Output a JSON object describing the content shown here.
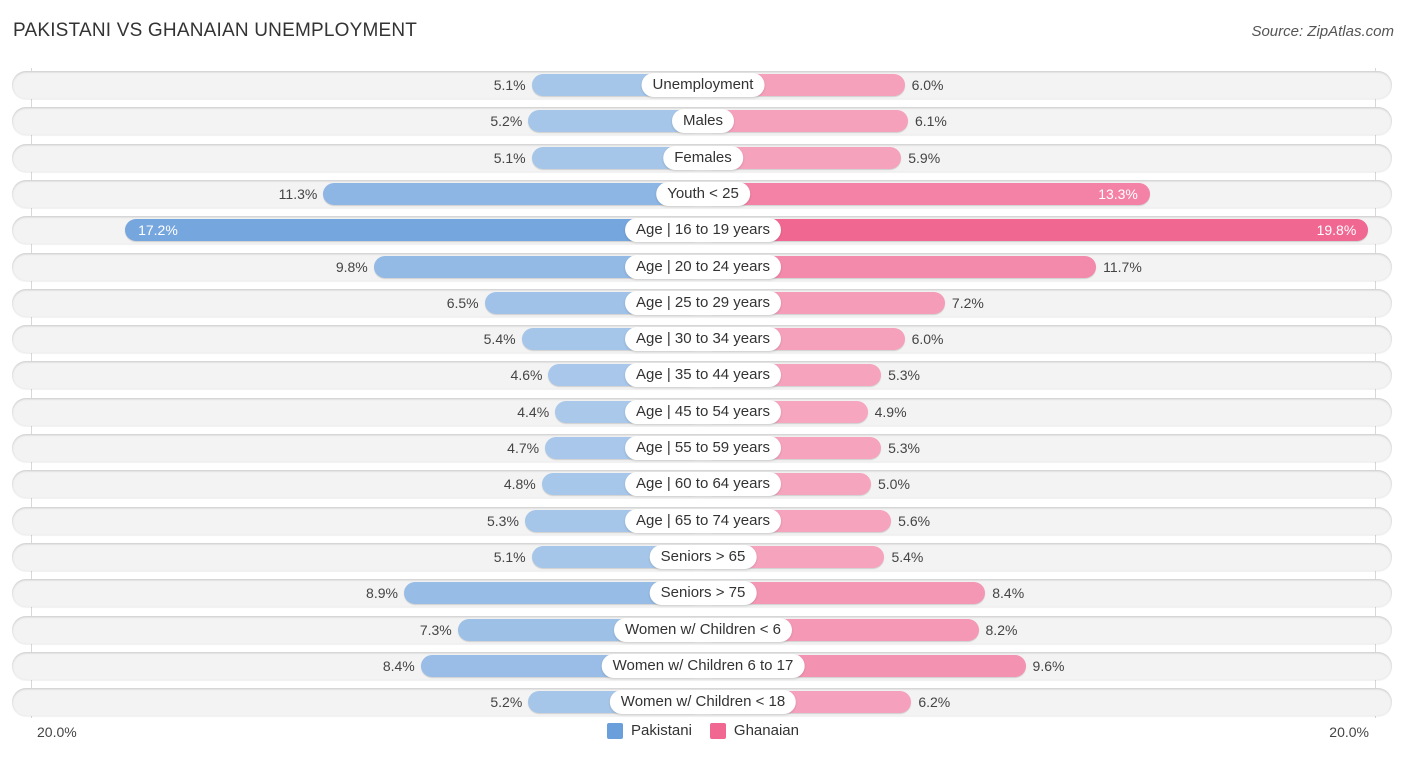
{
  "title": "PAKISTANI VS GHANAIAN UNEMPLOYMENT",
  "source": "Source: ZipAtlas.com",
  "colors": {
    "pakistani_light": "#a9c8ea",
    "pakistani_dark": "#6a9fdc",
    "ghanaian_light": "#f6a8c1",
    "ghanaian_dark": "#f06792"
  },
  "legend": [
    {
      "name": "Pakistani",
      "color": "#6a9fdc"
    },
    {
      "name": "Ghanaian",
      "color": "#f06792"
    }
  ],
  "axis": {
    "left_label": "20.0%",
    "right_label": "20.0%"
  },
  "chart_data": {
    "type": "bar",
    "orientation": "horizontal-diverging",
    "title": "PAKISTANI VS GHANAIAN UNEMPLOYMENT",
    "xlabel": "",
    "ylabel": "",
    "xlim": [
      -20,
      20
    ],
    "unit": "%",
    "legend_position": "bottom",
    "categories": [
      "Unemployment",
      "Males",
      "Females",
      "Youth < 25",
      "Age | 16 to 19 years",
      "Age | 20 to 24 years",
      "Age | 25 to 29 years",
      "Age | 30 to 34 years",
      "Age | 35 to 44 years",
      "Age | 45 to 54 years",
      "Age | 55 to 59 years",
      "Age | 60 to 64 years",
      "Age | 65 to 74 years",
      "Seniors > 65",
      "Seniors > 75",
      "Women w/ Children < 6",
      "Women w/ Children 6 to 17",
      "Women w/ Children < 18"
    ],
    "series": [
      {
        "name": "Pakistani",
        "side": "left",
        "values": [
          5.1,
          5.2,
          5.1,
          11.3,
          17.2,
          9.8,
          6.5,
          5.4,
          4.6,
          4.4,
          4.7,
          4.8,
          5.3,
          5.1,
          8.9,
          7.3,
          8.4,
          5.2
        ],
        "labels": [
          "5.1%",
          "5.2%",
          "5.1%",
          "11.3%",
          "17.2%",
          "9.8%",
          "6.5%",
          "5.4%",
          "4.6%",
          "4.4%",
          "4.7%",
          "4.8%",
          "5.3%",
          "5.1%",
          "8.9%",
          "7.3%",
          "8.4%",
          "5.2%"
        ]
      },
      {
        "name": "Ghanaian",
        "side": "right",
        "values": [
          6.0,
          6.1,
          5.9,
          13.3,
          19.8,
          11.7,
          7.2,
          6.0,
          5.3,
          4.9,
          5.3,
          5.0,
          5.6,
          5.4,
          8.4,
          8.2,
          9.6,
          6.2
        ],
        "labels": [
          "6.0%",
          "6.1%",
          "5.9%",
          "13.3%",
          "19.8%",
          "11.7%",
          "7.2%",
          "6.0%",
          "5.3%",
          "4.9%",
          "5.3%",
          "5.0%",
          "5.6%",
          "5.4%",
          "8.4%",
          "8.2%",
          "9.6%",
          "6.2%"
        ]
      }
    ]
  }
}
